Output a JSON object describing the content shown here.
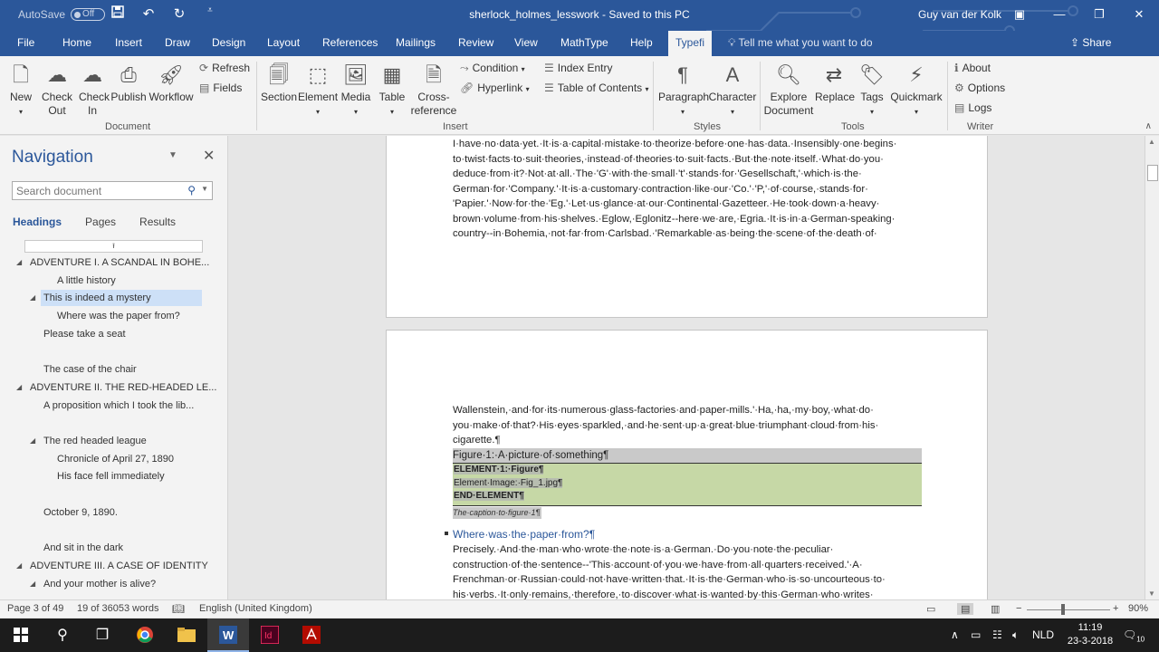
{
  "titlebar": {
    "autosave_label": "AutoSave",
    "autosave_state": "Off",
    "document_title": "sherlock_holmes_lesswork  -  Saved to this PC",
    "user_name": "Guy van der Kolk",
    "icons": [
      "save-icon",
      "undo-icon",
      "redo-icon",
      "customize-qat-icon"
    ]
  },
  "menu": {
    "tabs": [
      "File",
      "Home",
      "Insert",
      "Draw",
      "Design",
      "Layout",
      "References",
      "Mailings",
      "Review",
      "View",
      "MathType",
      "Help",
      "Typefi"
    ],
    "active_tab": "Typefi",
    "tell_me": "Tell me what you want to do",
    "share": "Share"
  },
  "ribbon": {
    "document_group": {
      "label": "Document",
      "new": "New",
      "check_out": "Check Out",
      "check_in": "Check In",
      "publish": "Publish",
      "workflow": "Workflow",
      "refresh": "Refresh",
      "fields": "Fields"
    },
    "insert_group": {
      "label": "Insert",
      "section": "Section",
      "element": "Element",
      "media": "Media",
      "table": "Table",
      "cross_reference": "Cross-reference",
      "condition": "Condition",
      "hyperlink": "Hyperlink",
      "index_entry": "Index Entry",
      "table_of_contents": "Table of Contents"
    },
    "styles_group": {
      "label": "Styles",
      "paragraph": "Paragraph",
      "character": "Character"
    },
    "tools_group": {
      "label": "Tools",
      "explore_document": "Explore Document",
      "replace": "Replace",
      "tags": "Tags",
      "quickmark": "Quickmark"
    },
    "writer_group": {
      "label": "Writer",
      "about": "About",
      "options": "Options",
      "logs": "Logs"
    }
  },
  "navigation": {
    "title": "Navigation",
    "search_placeholder": "Search document",
    "tabs": [
      "Headings",
      "Pages",
      "Results"
    ],
    "active_tab": "Headings",
    "headings": [
      {
        "text": "ADVENTURE I. A SCANDAL IN BOHE...",
        "level": 1,
        "expanded": true
      },
      {
        "text": "A little history",
        "level": 3
      },
      {
        "text": "This is indeed a mystery",
        "level": 2,
        "expanded": true,
        "selected": true
      },
      {
        "text": "Where was the paper from?",
        "level": 3
      },
      {
        "text": "Please take a seat",
        "level": 2
      },
      {
        "text": "",
        "level": 2
      },
      {
        "text": "The case of the chair",
        "level": 2
      },
      {
        "text": "ADVENTURE II. THE RED-HEADED LE...",
        "level": 1,
        "expanded": true
      },
      {
        "text": "A proposition which I took the lib...",
        "level": 2
      },
      {
        "text": "",
        "level": 2
      },
      {
        "text": "The red headed league",
        "level": 2,
        "expanded": true
      },
      {
        "text": "Chronicle of April 27, 1890",
        "level": 3
      },
      {
        "text": "His face fell immediately",
        "level": 3
      },
      {
        "text": "",
        "level": 2
      },
      {
        "text": "October 9, 1890.",
        "level": 2
      },
      {
        "text": "",
        "level": 2
      },
      {
        "text": "And sit in the dark",
        "level": 2
      },
      {
        "text": "ADVENTURE III. A CASE OF IDENTITY",
        "level": 1,
        "expanded": true
      },
      {
        "text": "And your mother is alive?",
        "level": 2,
        "expanded": true
      }
    ]
  },
  "document": {
    "page1_lines": [
      "I·have·no·data·yet.·It·is·a·capital·mistake·to·theorize·before·one·has·data.·Insensibly·one·begins·",
      "to·twist·facts·to·suit·theories,·instead·of·theories·to·suit·facts.·But·the·note·itself.·What·do·you·",
      "deduce·from·it?·Not·at·all.·The·'G'·with·the·small·'t'·stands·for·'Gesellschaft,'·which·is·the·",
      "German·for·'Company.'·It·is·a·customary·contraction·like·our·'Co.'·'P,'·of·course,·stands·for·",
      "'Papier.'·Now·for·the·'Eg.'·Let·us·glance·at·our·Continental·Gazetteer.·He·took·down·a·heavy·",
      "brown·volume·from·his·shelves.·Eglow,·Eglonitz--here·we·are,·Egria.·It·is·in·a·German-speaking·",
      "country--in·Bohemia,·not·far·from·Carlsbad.·'Remarkable·as·being·the·scene·of·the·death·of·"
    ],
    "page2_lines": [
      "Wallenstein,·and·for·its·numerous·glass-factories·and·paper-mills.'·Ha,·ha,·my·boy,·what·do·",
      "you·make·of·that?·His·eyes·sparkled,·and·he·sent·up·a·great·blue·triumphant·cloud·from·his·",
      "cigarette.¶"
    ],
    "figure_title": "Figure·1:·A·picture·of·something¶",
    "element_lines": [
      "ELEMENT·1:·Figure¶",
      "Element·Image:·Fig_1.jpg¶",
      "END·ELEMENT¶"
    ],
    "caption": "The·caption·to·figure·1¶",
    "heading": "Where·was·the·paper·from?¶",
    "page2_after_lines": [
      "Precisely.·And·the·man·who·wrote·the·note·is·a·German.·Do·you·note·the·peculiar·",
      "construction·of·the·sentence--'This·account·of·you·we·have·from·all·quarters·received.'·A·",
      "Frenchman·or·Russian·could·not·have·written·that.·It·is·the·German·who·is·so·uncourteous·to·",
      "his·verbs.·It·only·remains,·therefore,·to·discover·what·is·wanted·by·this·German·who·writes·"
    ]
  },
  "status": {
    "page": "Page 3 of 49",
    "words": "19 of 36053 words",
    "language": "English (United Kingdom)",
    "zoom": "90%",
    "zoom_out": "−",
    "zoom_in": "+"
  },
  "taskbar": {
    "apps": [
      "windows-start-icon",
      "search-icon",
      "task-view-icon",
      "chrome-icon",
      "file-explorer-icon",
      "word-icon",
      "indesign-icon",
      "acrobat-icon"
    ],
    "language": "NLD",
    "time": "11:19",
    "date": "23-3-2018",
    "notifications": "10"
  },
  "colors": {
    "word_blue": "#2b579a",
    "element_green": "#c6d8a6",
    "highlight_gray": "#c9c9c9",
    "selection_blue": "#cde0f7"
  }
}
